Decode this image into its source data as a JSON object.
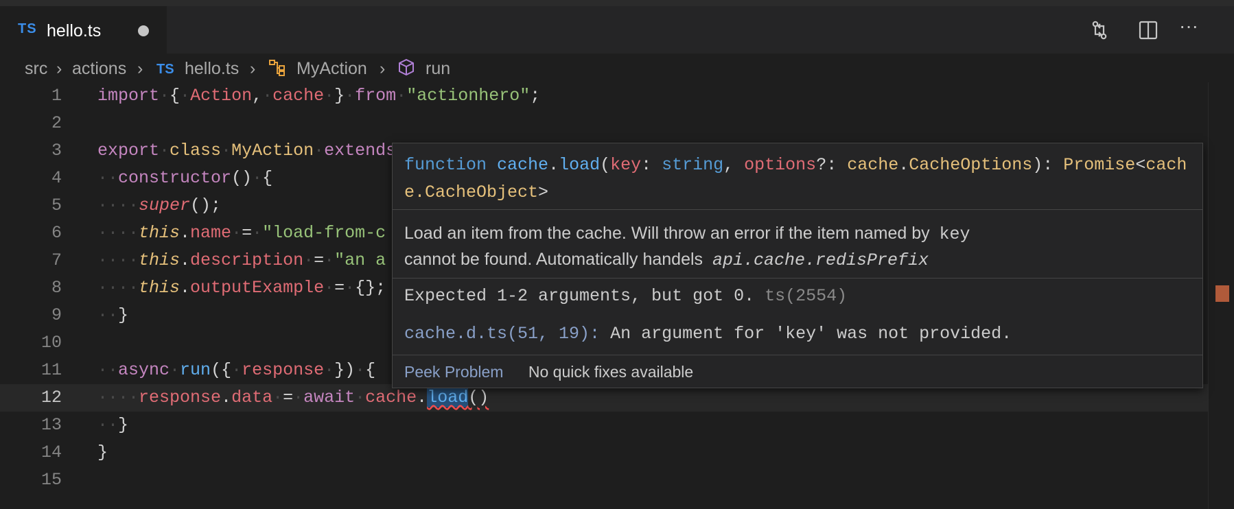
{
  "tab": {
    "lang": "TS",
    "filename": "hello.ts"
  },
  "toolbar": {
    "compare_icon": "git-compare-icon",
    "split_icon": "split-editor-icon",
    "more": "···"
  },
  "breadcrumb": {
    "items": [
      "src",
      "actions",
      "hello.ts",
      "MyAction",
      "run"
    ],
    "ts_badge": "TS"
  },
  "line_numbers": [
    "1",
    "2",
    "3",
    "4",
    "5",
    "6",
    "7",
    "8",
    "9",
    "10",
    "11",
    "12",
    "13",
    "14",
    "15"
  ],
  "hover": {
    "sig": {
      "function": "function",
      "cache1": "cache",
      "load": "load",
      "key": "key",
      "string": "string",
      "options": "options",
      "cache2": "cache",
      "cacheoptions": "CacheOptions",
      "promise": "Promise",
      "cacheobject": "cache.CacheObject"
    },
    "doc_line1": "Load an item from the cache. Will throw an error if the item named by",
    "doc_key": "key",
    "doc_line2": "cannot be found. Automatically handels",
    "doc_prefix": "api.cache.redisPrefix",
    "error": "Expected 1-2 arguments, but got 0.",
    "error_code": "ts(2554)",
    "related_loc": "cache.d.ts(51, 19):",
    "related_msg": "An argument for 'key' was not provided.",
    "peek": "Peek Problem",
    "no_fixes": "No quick fixes available"
  }
}
